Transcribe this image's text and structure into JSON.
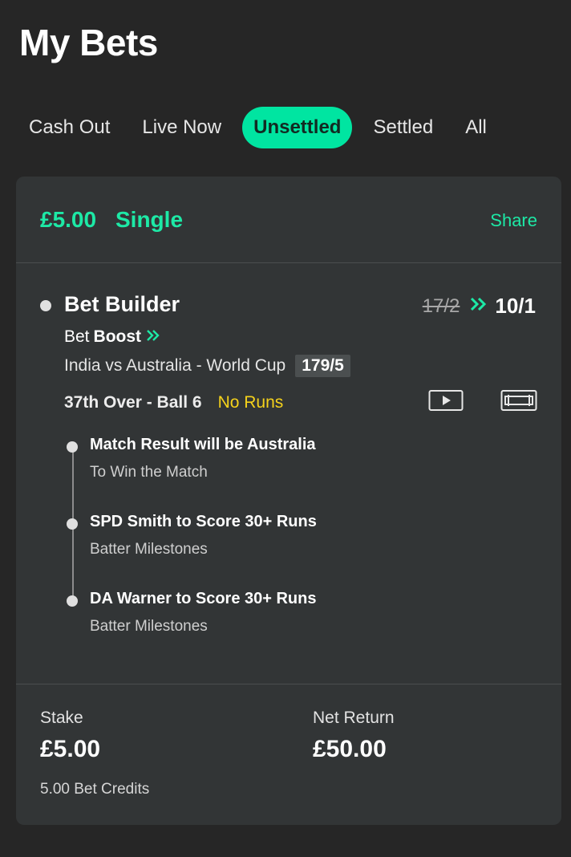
{
  "header": {
    "title": "My Bets"
  },
  "tabs": [
    {
      "label": "Cash Out",
      "active": false
    },
    {
      "label": "Live Now",
      "active": false
    },
    {
      "label": "Unsettled",
      "active": true
    },
    {
      "label": "Settled",
      "active": false
    },
    {
      "label": "All",
      "active": false
    }
  ],
  "bet": {
    "stake_amount": "£5.00",
    "type": "Single",
    "share_label": "Share",
    "builder_title": "Bet Builder",
    "odds_old": "17/2",
    "odds_new": "10/1",
    "boost_prefix": "Bet",
    "boost_label": "Boost",
    "match": "India vs Australia - World Cup",
    "score": "179/5",
    "over": "37th Over - Ball 6",
    "event": "No Runs",
    "selections": [
      {
        "title": "Match Result will be Australia",
        "market": "To Win the Match"
      },
      {
        "title": "SPD Smith to Score 30+ Runs",
        "market": "Batter Milestones"
      },
      {
        "title": "DA Warner to Score 30+ Runs",
        "market": "Batter Milestones"
      }
    ],
    "footer": {
      "stake_label": "Stake",
      "stake_value": "£5.00",
      "return_label": "Net Return",
      "return_value": "£50.00",
      "credits": "5.00 Bet Credits"
    }
  },
  "colors": {
    "background": "#262626",
    "card": "#323536",
    "accent": "#1de9a6",
    "active_tab": "#00e5a1",
    "event": "#f5d21b"
  },
  "icons": [
    "chevron-double-right-icon",
    "video-play-icon",
    "scoreboard-icon"
  ]
}
